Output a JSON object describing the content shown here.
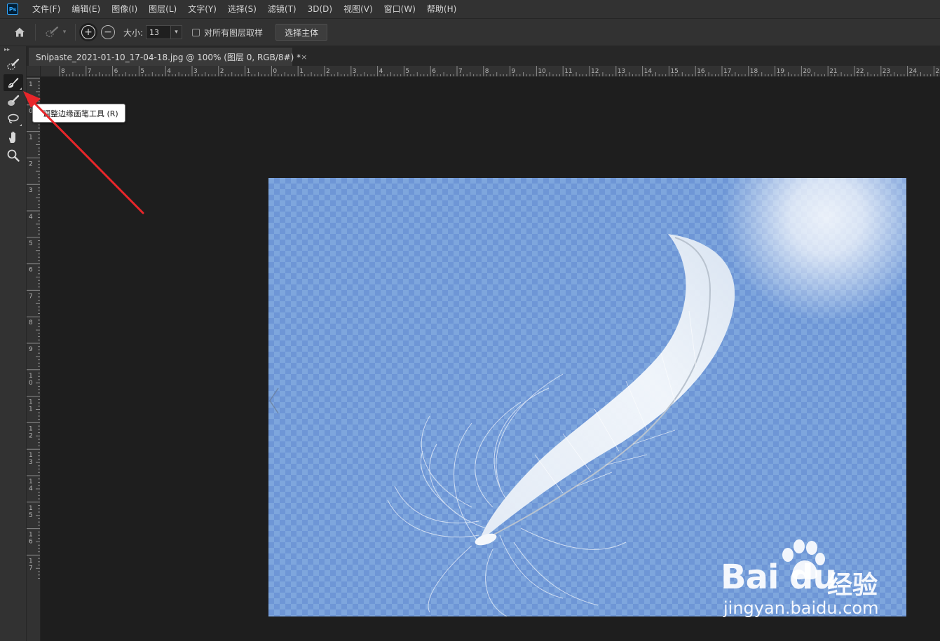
{
  "app": {
    "logo_text": "Ps"
  },
  "menu": {
    "items": [
      "文件(F)",
      "编辑(E)",
      "图像(I)",
      "图层(L)",
      "文字(Y)",
      "选择(S)",
      "滤镜(T)",
      "3D(D)",
      "视图(V)",
      "窗口(W)",
      "帮助(H)"
    ]
  },
  "options": {
    "add_symbol": "+",
    "subtract_symbol": "−",
    "size_label": "大小:",
    "size_value": "13",
    "dropdown_caret": "▾",
    "sample_all_label": "对所有图层取样",
    "select_subject_label": "选择主体"
  },
  "toolbar": {
    "collapse_glyph": "▸▸",
    "tools": [
      "quick-selection-tool",
      "refine-edge-brush-tool",
      "brush-tool",
      "lasso-tool",
      "hand-tool",
      "zoom-tool"
    ],
    "active_index": 1
  },
  "document": {
    "tab_title": "Snipaste_2021-01-10_17-04-18.jpg @ 100% (图层 0, RGB/8#) *",
    "close_glyph": "×"
  },
  "rulers": {
    "horizontal_labels": [
      "8",
      "7",
      "6",
      "5",
      "4",
      "3",
      "2",
      "1",
      "0",
      "1",
      "2",
      "3",
      "4",
      "5",
      "6",
      "7",
      "8",
      "9",
      "10",
      "11",
      "12",
      "13",
      "14",
      "15",
      "16",
      "17",
      "18",
      "19",
      "20",
      "21",
      "22",
      "23",
      "24",
      "25"
    ],
    "vertical_labels": [
      "1",
      "0",
      "1",
      "2",
      "3",
      "4",
      "5",
      "6",
      "7",
      "8",
      "9",
      "10",
      "11",
      "12",
      "13",
      "14",
      "15",
      "16",
      "17"
    ]
  },
  "tooltip": {
    "text": "调整边缘画笔工具 (R)"
  },
  "watermark": {
    "brand": "Bai du",
    "brand_cn": "经验",
    "url": "jingyan.baidu.com"
  },
  "colors": {
    "panel": "#323232",
    "canvas_bg": "#1e1e1e",
    "accent": "#31a8ff",
    "arrow": "#e8262a"
  }
}
